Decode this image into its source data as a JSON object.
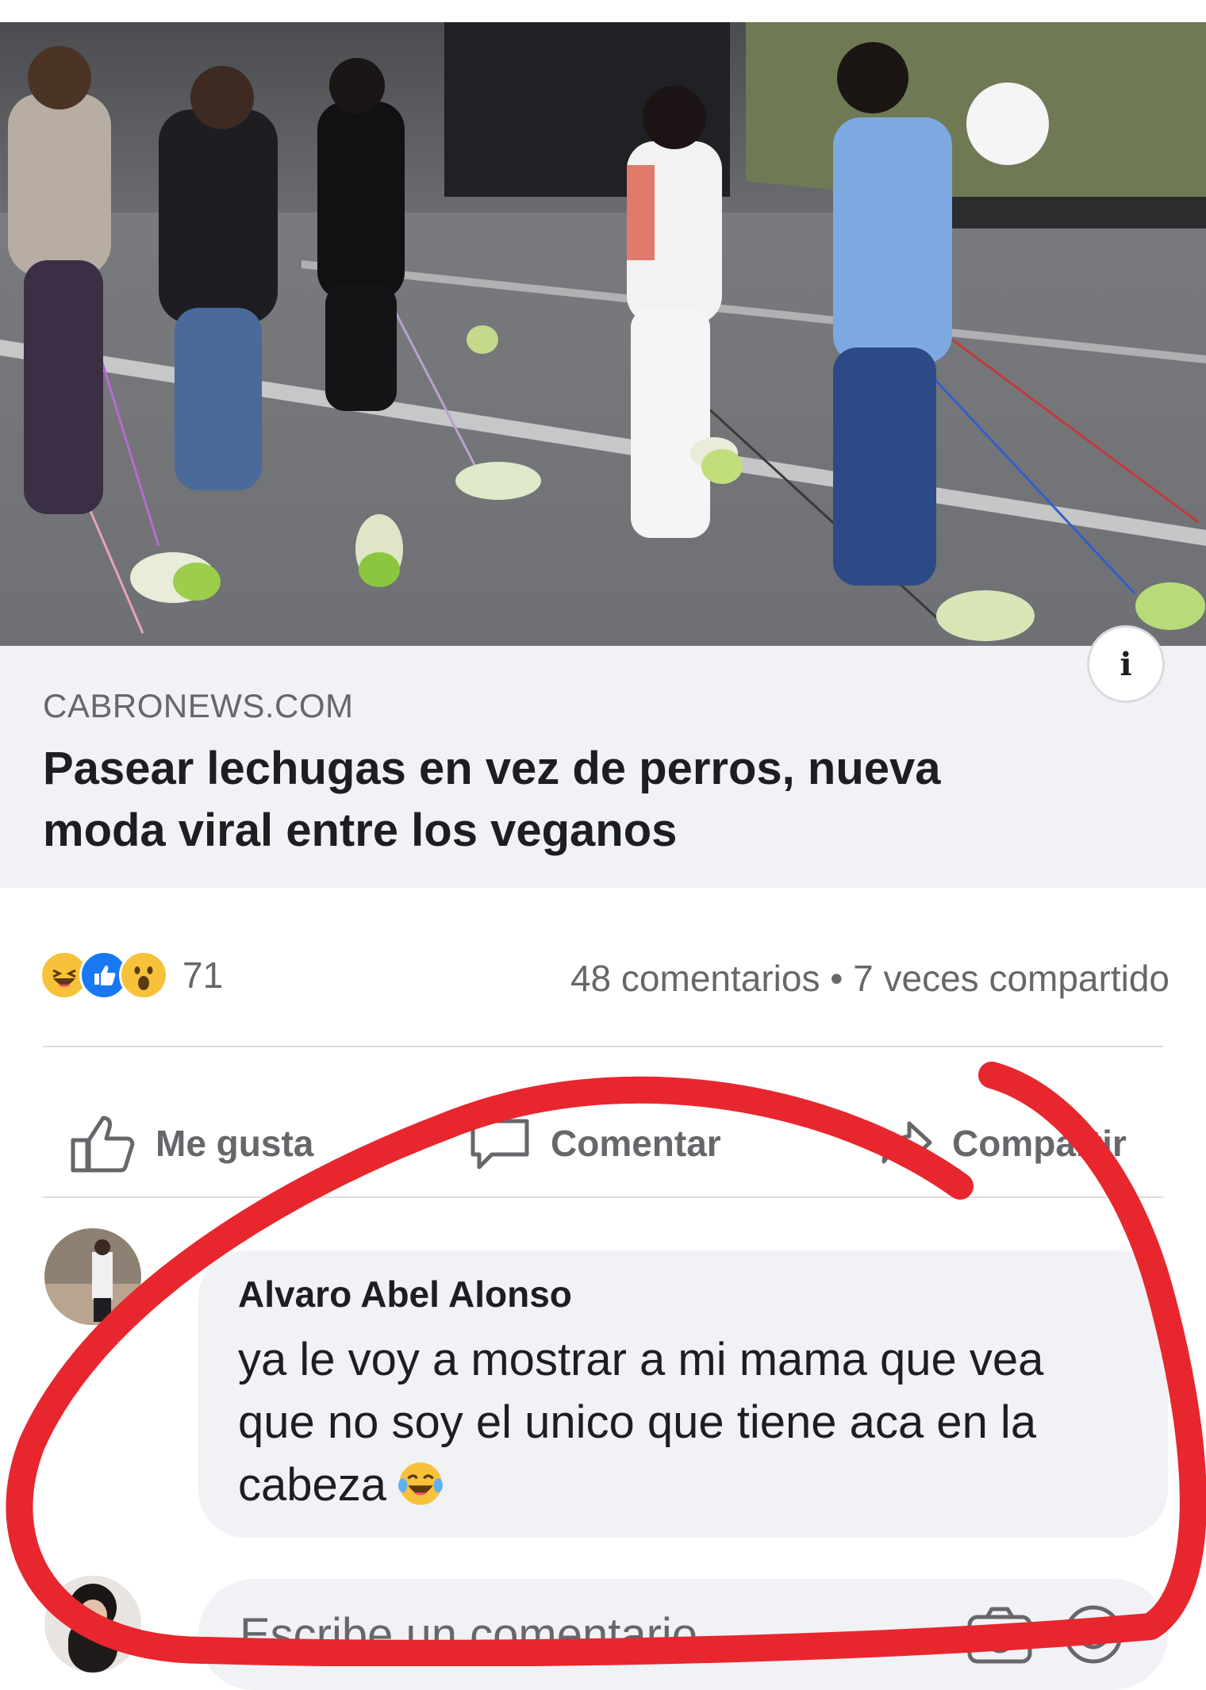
{
  "link_preview": {
    "domain": "CABRONEWS.COM",
    "headline": "Pasear lechugas en vez de perros, nueva moda viral entre los veganos"
  },
  "stats": {
    "reactions": [
      "haha-icon",
      "like-icon",
      "wow-icon"
    ],
    "reaction_count": "71",
    "comments_shares": "48 comentarios • 7 veces compartido"
  },
  "actions": {
    "like_label": "Me gusta",
    "comment_label": "Comentar",
    "share_label": "Compartir"
  },
  "comment": {
    "author": "Alvaro Abel Alonso",
    "text": "ya le voy a mostrar a mi mama que vea que no soy el unico que tiene aca en la cabeza",
    "emoji": "laughing-tears-emoji"
  },
  "composer": {
    "placeholder": "Escribe un comentario...",
    "camera_icon": "camera-icon",
    "emoji_icon": "smiley-icon"
  },
  "colors": {
    "annotation_red": "#e8262e",
    "facebook_blue": "#1877f2",
    "secondary_text": "#65676b",
    "bubble_bg": "#f0f2f5"
  }
}
